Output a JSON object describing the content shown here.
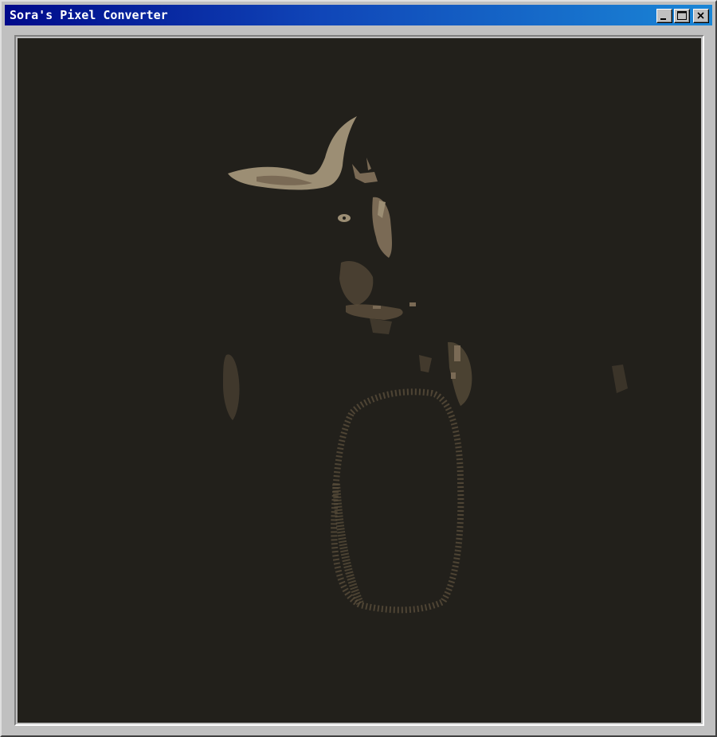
{
  "window": {
    "title": "Sora's Pixel Converter",
    "controls": {
      "minimize_icon": "minimize-icon",
      "maximize_icon": "maximize-icon",
      "close_icon": "close-icon"
    }
  },
  "canvas": {
    "background_color": "#22201b",
    "palette": [
      "#22201b",
      "#3a3427",
      "#5a4d3b",
      "#7a6a55",
      "#9c8e74"
    ]
  }
}
